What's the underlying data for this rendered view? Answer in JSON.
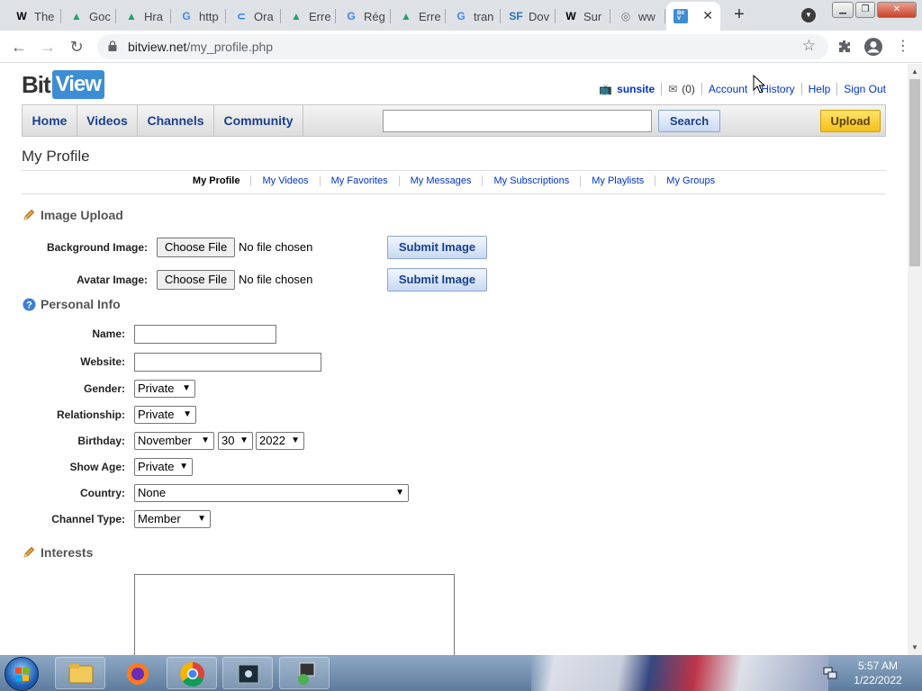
{
  "browser": {
    "tabs": [
      {
        "label": "The",
        "favicon": "W",
        "favicon_color": "#000000",
        "icon": "wikipedia-icon"
      },
      {
        "label": "Goc",
        "favicon": "▲",
        "favicon_color": "#1fa463",
        "icon": "google-drive-icon"
      },
      {
        "label": "Hra",
        "favicon": "▲",
        "favicon_color": "#1fa463",
        "icon": "google-drive-icon"
      },
      {
        "label": "http",
        "favicon": "G",
        "favicon_color": "#4285f4",
        "icon": "google-icon"
      },
      {
        "label": "Ora",
        "favicon": "⊂",
        "favicon_color": "#1a73e8",
        "icon": "oracle-icon"
      },
      {
        "label": "Erre",
        "favicon": "▲",
        "favicon_color": "#1fa463",
        "icon": "google-drive-icon"
      },
      {
        "label": "Rég",
        "favicon": "G",
        "favicon_color": "#4285f4",
        "icon": "google-icon"
      },
      {
        "label": "Erre",
        "favicon": "▲",
        "favicon_color": "#1fa463",
        "icon": "google-drive-icon"
      },
      {
        "label": "tran",
        "favicon": "G",
        "favicon_color": "#4285f4",
        "icon": "google-icon"
      },
      {
        "label": "Dov",
        "favicon": "SF",
        "favicon_color": "#2b6fb5",
        "icon": "sourceforge-icon"
      },
      {
        "label": "Sur",
        "favicon": "W",
        "favicon_color": "#000000",
        "icon": "wikipedia-icon"
      },
      {
        "label": "ww",
        "favicon": "◎",
        "favicon_color": "#777777",
        "icon": "globe-icon"
      }
    ],
    "active_tab": {
      "favicon": "Bit\nView",
      "icon": "bitview-icon"
    },
    "new_tab": "+",
    "url_host": "bitview.net",
    "url_path": "/my_profile.php"
  },
  "site": {
    "logo_bit": "Bit",
    "logo_view": "View",
    "user": {
      "username": "sunsite",
      "messages": "(0)",
      "links": [
        "Account",
        "History",
        "Help",
        "Sign Out"
      ]
    },
    "nav": [
      "Home",
      "Videos",
      "Channels",
      "Community"
    ],
    "search_button": "Search",
    "upload_button": "Upload"
  },
  "page": {
    "title": "My Profile",
    "subnav": [
      "My Profile",
      "My Videos",
      "My Favorites",
      "My Messages",
      "My Subscriptions",
      "My Playlists",
      "My Groups"
    ],
    "image_upload": {
      "heading": "Image Upload",
      "rows": [
        {
          "label": "Background Image:",
          "choose": "Choose File",
          "status": "No file chosen",
          "submit": "Submit Image"
        },
        {
          "label": "Avatar Image:",
          "choose": "Choose File",
          "status": "No file chosen",
          "submit": "Submit Image"
        }
      ]
    },
    "personal_info": {
      "heading": "Personal Info",
      "name_label": "Name:",
      "name_value": "",
      "website_label": "Website:",
      "website_value": "",
      "gender_label": "Gender:",
      "gender_value": "Private",
      "relationship_label": "Relationship:",
      "relationship_value": "Private",
      "birthday_label": "Birthday:",
      "birthday_month": "November",
      "birthday_day": "30",
      "birthday_year": "2022",
      "show_age_label": "Show Age:",
      "show_age_value": "Private",
      "country_label": "Country:",
      "country_value": "None",
      "channel_type_label": "Channel Type:",
      "channel_type_value": "Member"
    },
    "interests": {
      "heading": "Interests",
      "value": ""
    }
  },
  "taskbar": {
    "time": "5:57 AM",
    "date": "1/22/2022"
  }
}
